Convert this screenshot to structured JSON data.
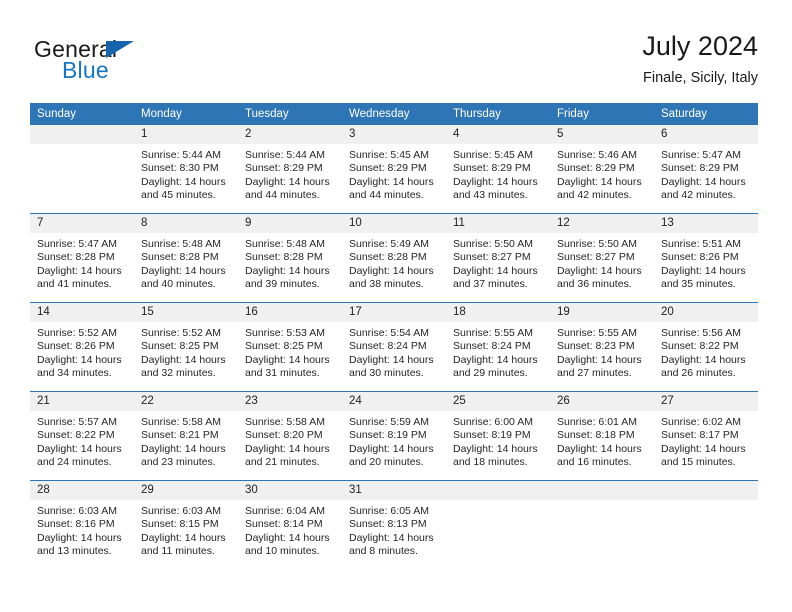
{
  "logo": {
    "word1": "General",
    "word2": "Blue",
    "triangle_color": "#1465ab",
    "blue_color": "#1577c4"
  },
  "header": {
    "title": "July 2024",
    "subtitle": "Finale, Sicily, Italy"
  },
  "theme": {
    "header_bg": "#2e75b6",
    "day_band_bg": "#f0f0f0",
    "text": "#262626"
  },
  "weekdays": [
    "Sunday",
    "Monday",
    "Tuesday",
    "Wednesday",
    "Thursday",
    "Friday",
    "Saturday"
  ],
  "weeks": [
    [
      {
        "date": "",
        "lines": []
      },
      {
        "date": "1",
        "lines": [
          "Sunrise: 5:44 AM",
          "Sunset: 8:30 PM",
          "Daylight: 14 hours",
          "and 45 minutes."
        ]
      },
      {
        "date": "2",
        "lines": [
          "Sunrise: 5:44 AM",
          "Sunset: 8:29 PM",
          "Daylight: 14 hours",
          "and 44 minutes."
        ]
      },
      {
        "date": "3",
        "lines": [
          "Sunrise: 5:45 AM",
          "Sunset: 8:29 PM",
          "Daylight: 14 hours",
          "and 44 minutes."
        ]
      },
      {
        "date": "4",
        "lines": [
          "Sunrise: 5:45 AM",
          "Sunset: 8:29 PM",
          "Daylight: 14 hours",
          "and 43 minutes."
        ]
      },
      {
        "date": "5",
        "lines": [
          "Sunrise: 5:46 AM",
          "Sunset: 8:29 PM",
          "Daylight: 14 hours",
          "and 42 minutes."
        ]
      },
      {
        "date": "6",
        "lines": [
          "Sunrise: 5:47 AM",
          "Sunset: 8:29 PM",
          "Daylight: 14 hours",
          "and 42 minutes."
        ]
      }
    ],
    [
      {
        "date": "7",
        "lines": [
          "Sunrise: 5:47 AM",
          "Sunset: 8:28 PM",
          "Daylight: 14 hours",
          "and 41 minutes."
        ]
      },
      {
        "date": "8",
        "lines": [
          "Sunrise: 5:48 AM",
          "Sunset: 8:28 PM",
          "Daylight: 14 hours",
          "and 40 minutes."
        ]
      },
      {
        "date": "9",
        "lines": [
          "Sunrise: 5:48 AM",
          "Sunset: 8:28 PM",
          "Daylight: 14 hours",
          "and 39 minutes."
        ]
      },
      {
        "date": "10",
        "lines": [
          "Sunrise: 5:49 AM",
          "Sunset: 8:28 PM",
          "Daylight: 14 hours",
          "and 38 minutes."
        ]
      },
      {
        "date": "11",
        "lines": [
          "Sunrise: 5:50 AM",
          "Sunset: 8:27 PM",
          "Daylight: 14 hours",
          "and 37 minutes."
        ]
      },
      {
        "date": "12",
        "lines": [
          "Sunrise: 5:50 AM",
          "Sunset: 8:27 PM",
          "Daylight: 14 hours",
          "and 36 minutes."
        ]
      },
      {
        "date": "13",
        "lines": [
          "Sunrise: 5:51 AM",
          "Sunset: 8:26 PM",
          "Daylight: 14 hours",
          "and 35 minutes."
        ]
      }
    ],
    [
      {
        "date": "14",
        "lines": [
          "Sunrise: 5:52 AM",
          "Sunset: 8:26 PM",
          "Daylight: 14 hours",
          "and 34 minutes."
        ]
      },
      {
        "date": "15",
        "lines": [
          "Sunrise: 5:52 AM",
          "Sunset: 8:25 PM",
          "Daylight: 14 hours",
          "and 32 minutes."
        ]
      },
      {
        "date": "16",
        "lines": [
          "Sunrise: 5:53 AM",
          "Sunset: 8:25 PM",
          "Daylight: 14 hours",
          "and 31 minutes."
        ]
      },
      {
        "date": "17",
        "lines": [
          "Sunrise: 5:54 AM",
          "Sunset: 8:24 PM",
          "Daylight: 14 hours",
          "and 30 minutes."
        ]
      },
      {
        "date": "18",
        "lines": [
          "Sunrise: 5:55 AM",
          "Sunset: 8:24 PM",
          "Daylight: 14 hours",
          "and 29 minutes."
        ]
      },
      {
        "date": "19",
        "lines": [
          "Sunrise: 5:55 AM",
          "Sunset: 8:23 PM",
          "Daylight: 14 hours",
          "and 27 minutes."
        ]
      },
      {
        "date": "20",
        "lines": [
          "Sunrise: 5:56 AM",
          "Sunset: 8:22 PM",
          "Daylight: 14 hours",
          "and 26 minutes."
        ]
      }
    ],
    [
      {
        "date": "21",
        "lines": [
          "Sunrise: 5:57 AM",
          "Sunset: 8:22 PM",
          "Daylight: 14 hours",
          "and 24 minutes."
        ]
      },
      {
        "date": "22",
        "lines": [
          "Sunrise: 5:58 AM",
          "Sunset: 8:21 PM",
          "Daylight: 14 hours",
          "and 23 minutes."
        ]
      },
      {
        "date": "23",
        "lines": [
          "Sunrise: 5:58 AM",
          "Sunset: 8:20 PM",
          "Daylight: 14 hours",
          "and 21 minutes."
        ]
      },
      {
        "date": "24",
        "lines": [
          "Sunrise: 5:59 AM",
          "Sunset: 8:19 PM",
          "Daylight: 14 hours",
          "and 20 minutes."
        ]
      },
      {
        "date": "25",
        "lines": [
          "Sunrise: 6:00 AM",
          "Sunset: 8:19 PM",
          "Daylight: 14 hours",
          "and 18 minutes."
        ]
      },
      {
        "date": "26",
        "lines": [
          "Sunrise: 6:01 AM",
          "Sunset: 8:18 PM",
          "Daylight: 14 hours",
          "and 16 minutes."
        ]
      },
      {
        "date": "27",
        "lines": [
          "Sunrise: 6:02 AM",
          "Sunset: 8:17 PM",
          "Daylight: 14 hours",
          "and 15 minutes."
        ]
      }
    ],
    [
      {
        "date": "28",
        "lines": [
          "Sunrise: 6:03 AM",
          "Sunset: 8:16 PM",
          "Daylight: 14 hours",
          "and 13 minutes."
        ]
      },
      {
        "date": "29",
        "lines": [
          "Sunrise: 6:03 AM",
          "Sunset: 8:15 PM",
          "Daylight: 14 hours",
          "and 11 minutes."
        ]
      },
      {
        "date": "30",
        "lines": [
          "Sunrise: 6:04 AM",
          "Sunset: 8:14 PM",
          "Daylight: 14 hours",
          "and 10 minutes."
        ]
      },
      {
        "date": "31",
        "lines": [
          "Sunrise: 6:05 AM",
          "Sunset: 8:13 PM",
          "Daylight: 14 hours",
          "and 8 minutes."
        ]
      },
      {
        "date": "",
        "lines": []
      },
      {
        "date": "",
        "lines": []
      },
      {
        "date": "",
        "lines": []
      }
    ]
  ]
}
